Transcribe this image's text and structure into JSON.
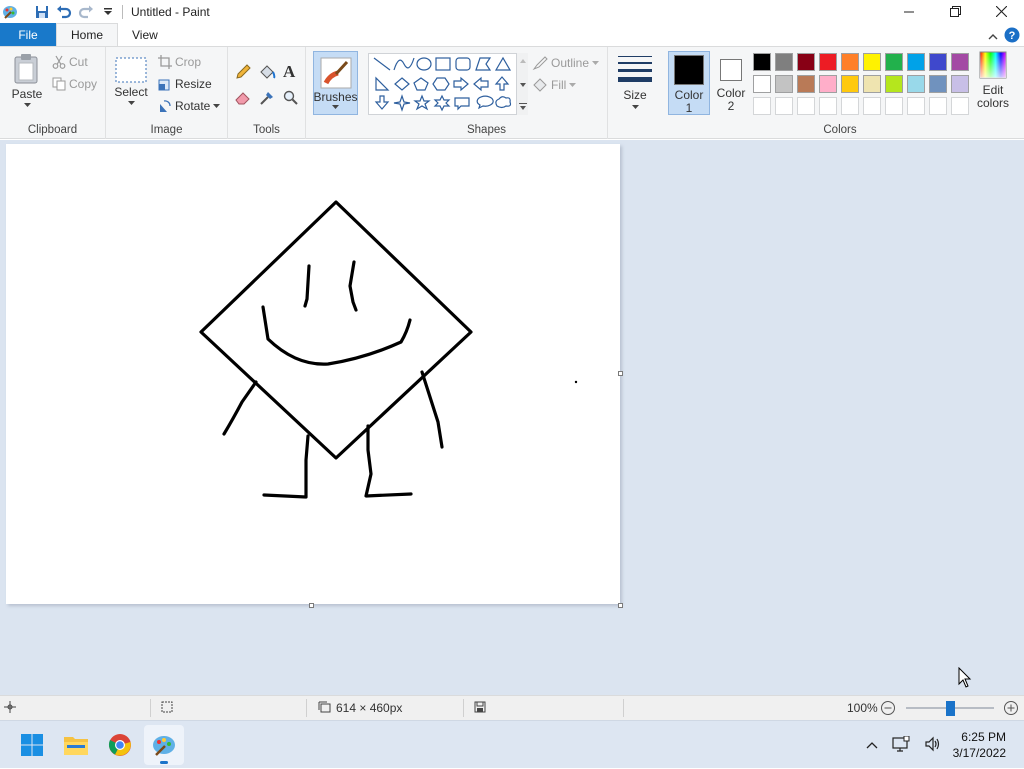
{
  "window": {
    "title": "Untitled - Paint"
  },
  "tabs": [
    {
      "label": "File"
    },
    {
      "label": "Home"
    },
    {
      "label": "View"
    }
  ],
  "ribbon": {
    "clipboard": {
      "paste": "Paste",
      "cut": "Cut",
      "copy": "Copy",
      "group": "Clipboard"
    },
    "image": {
      "select": "Select",
      "crop": "Crop",
      "resize": "Resize",
      "rotate": "Rotate",
      "group": "Image"
    },
    "tools": {
      "group": "Tools"
    },
    "brushes": {
      "label": "Brushes"
    },
    "shapes": {
      "outline": "Outline",
      "fill": "Fill",
      "group": "Shapes"
    },
    "size": {
      "label": "Size"
    },
    "colors": {
      "color1_line1": "Color",
      "color1_line2": "1",
      "color2_line1": "Color",
      "color2_line2": "2",
      "edit_line1": "Edit",
      "edit_line2": "colors",
      "group": "Colors",
      "color1_value": "#000000",
      "color2_value": "#ffffff",
      "palette_row1": [
        "#000000",
        "#7f7f7f",
        "#880015",
        "#ed1c24",
        "#ff7f27",
        "#fff200",
        "#22b14c",
        "#00a2e8",
        "#3f48cc",
        "#a349a4"
      ],
      "palette_row2": [
        "#ffffff",
        "#c3c3c3",
        "#b97a57",
        "#ffaec9",
        "#ffc90e",
        "#efe4b0",
        "#b5e61d",
        "#99d9ea",
        "#7092be",
        "#c8bfe7"
      ],
      "palette_row3": [
        "#ffffff",
        "#ffffff",
        "#ffffff",
        "#ffffff",
        "#ffffff",
        "#ffffff",
        "#ffffff",
        "#ffffff",
        "#ffffff",
        "#ffffff"
      ]
    }
  },
  "status": {
    "dimensions": "614 × 460px",
    "zoom": "100%",
    "zoom_level": 1.0
  },
  "taskbar": {
    "time": "6:25 PM",
    "date": "3/17/2022"
  }
}
